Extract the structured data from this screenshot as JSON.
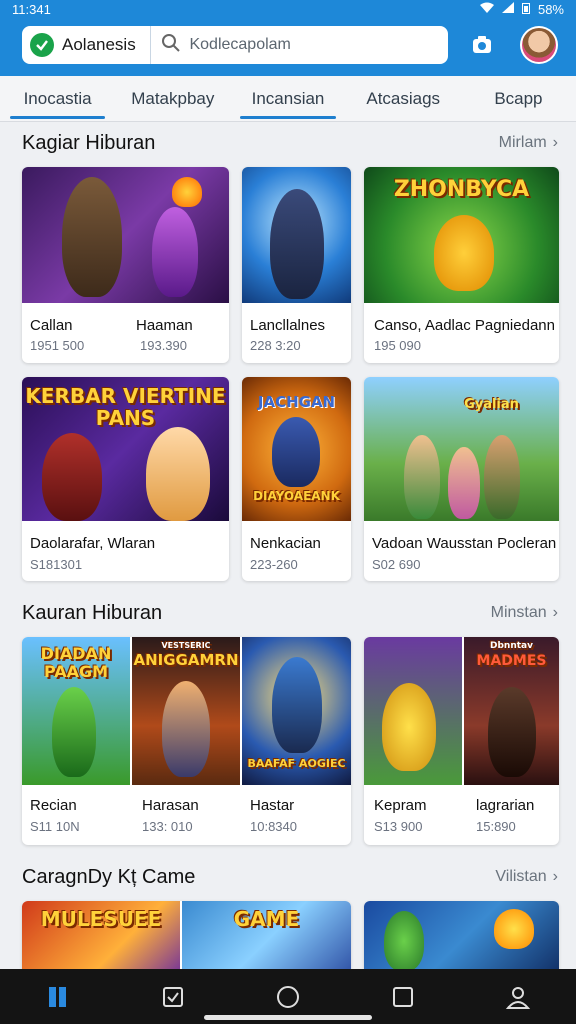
{
  "status": {
    "time": "11:341",
    "battery": "58%"
  },
  "header": {
    "app_name": "Aolanesis",
    "search_placeholder": "Kodlecapolam"
  },
  "tabs": [
    {
      "label": "Inocastia",
      "active": true
    },
    {
      "label": "Matakpbay",
      "active": false
    },
    {
      "label": "Incansian",
      "active": true
    },
    {
      "label": "Atcasiags",
      "active": false
    },
    {
      "label": "Bcapp",
      "active": false
    }
  ],
  "sections": [
    {
      "title": "Kagiar Hiburan",
      "more": "Mirlam",
      "cards": [
        {
          "name": "Callan",
          "meta": "1951 500",
          "name2": "Haaman",
          "meta2": "193.390"
        },
        {
          "name": "Lancllalnes",
          "meta": "228 3:20"
        },
        {
          "name": "Canso, Aadlac Pagniedann",
          "meta": "195 090"
        },
        {
          "name": "Daolarafar, Wlaran",
          "meta": "S181301",
          "art": "KERBAR VIERTINE PANS"
        },
        {
          "name": "Nenkacian",
          "meta": "223-260",
          "art": "JACHGAN"
        },
        {
          "name": "Vadoan Wausstan Pocleran",
          "meta": "S02 690"
        }
      ],
      "arts": {
        "card3": "ZHONBYCA",
        "card5_banner": "DIAYOAEANK",
        "card6": "Gyalian"
      }
    },
    {
      "title": "Kauran Hiburan",
      "more": "Minstan",
      "cards": [
        {
          "name": "Recian",
          "meta": "S11 10N",
          "art": "DIADAN PAAGM"
        },
        {
          "name": "Harasan",
          "meta": "133: 010",
          "art": "ANIGGAMRN",
          "pre": "VESTSERIC"
        },
        {
          "name": "Hastar",
          "meta": "10:8340",
          "art": "BAAFAF AOGIEC"
        },
        {
          "name": "Kepram",
          "meta": "S13 900"
        },
        {
          "name": "lagrarian",
          "meta": "15:890",
          "art": "MADMES",
          "pre": "Dbnntav"
        }
      ]
    },
    {
      "title": "CaragnDy Kț Came",
      "more": "Vilistan",
      "arts": [
        "MULESUEE",
        "GAME"
      ]
    }
  ]
}
